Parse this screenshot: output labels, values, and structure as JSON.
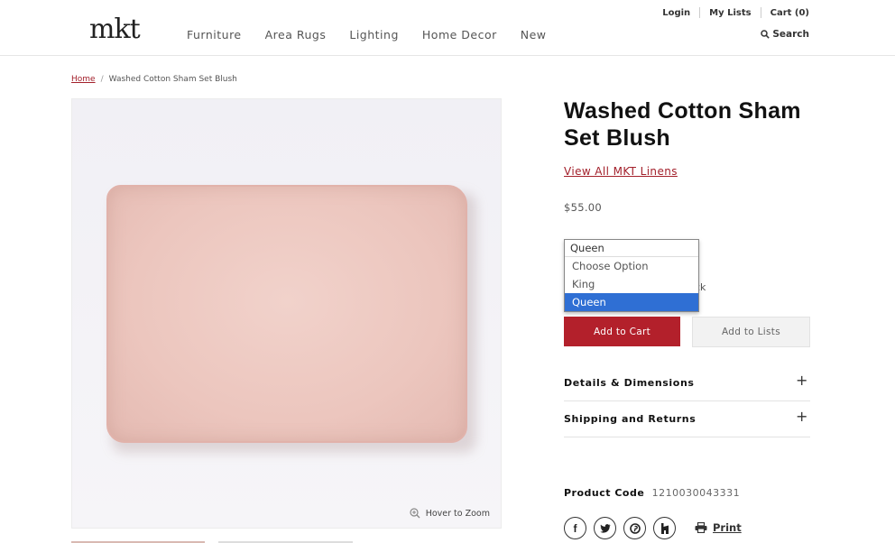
{
  "header": {
    "logo": "mkt",
    "nav": [
      "Furniture",
      "Area Rugs",
      "Lighting",
      "Home Decor",
      "New"
    ],
    "login": "Login",
    "my_lists": "My Lists",
    "cart": "Cart (0)",
    "search": "Search"
  },
  "breadcrumb": {
    "home": "Home",
    "separator": "/",
    "current": "Washed Cotton Sham Set Blush"
  },
  "image": {
    "zoom_hint": "Hover to Zoom"
  },
  "product": {
    "title": "Washed Cotton Sham Set Blush",
    "view_all": "View All MKT Linens",
    "price": "$55.00",
    "stock_fragment": "ck",
    "size_select": {
      "current": "Queen",
      "options": [
        "Choose Option",
        "King",
        "Queen"
      ],
      "selected": "Queen"
    },
    "add_to_cart": "Add to Cart",
    "add_to_lists": "Add to Lists",
    "accordions": [
      "Details & Dimensions",
      "Shipping and Returns"
    ],
    "product_code_label": "Product Code",
    "product_code": "1210030043331",
    "print": "Print"
  },
  "social": [
    "facebook-icon",
    "twitter-icon",
    "pinterest-icon",
    "houzz-icon"
  ],
  "colors": {
    "accent": "#b3202b",
    "link": "#a3202b",
    "select_highlight": "#2f6fd4"
  }
}
